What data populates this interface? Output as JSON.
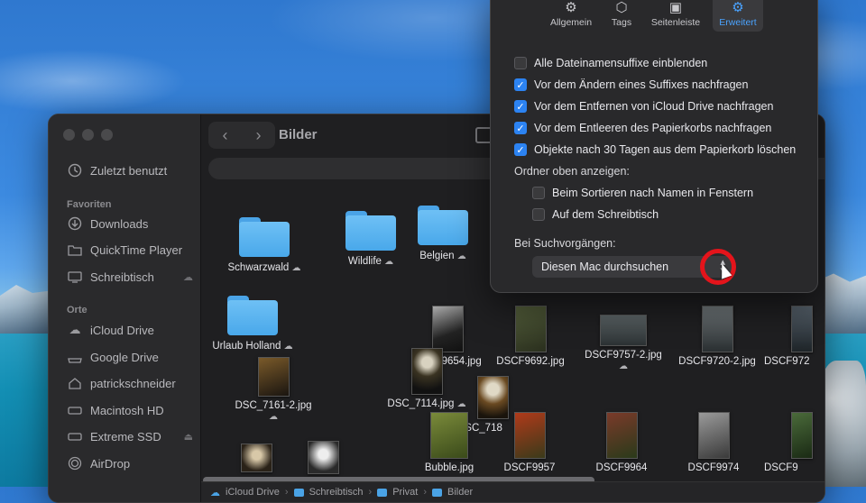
{
  "finder": {
    "title": "Bilder",
    "sidebar": {
      "recent": "Zuletzt benutzt",
      "favorites_header": "Favoriten",
      "favorites": [
        "Downloads",
        "QuickTime Player",
        "Schreibtisch"
      ],
      "places_header": "Orte",
      "places": [
        "iCloud Drive",
        "Google Drive",
        "patrickschneider",
        "Macintosh HD",
        "Extreme SSD",
        "AirDrop"
      ]
    },
    "folders": [
      {
        "name": "Schwarzwald"
      },
      {
        "name": "Wildlife"
      },
      {
        "name": "Belgien"
      },
      {
        "name": "Urlaub Holland"
      }
    ],
    "files": {
      "f1": "DSCF9654.jpg",
      "f2": "DSCF9692.jpg",
      "f3": "DSCF9757-2.jpg",
      "f4": "DSCF9720-2.jpg",
      "f5": "DSCF972",
      "f6": "DSC_7161-2.jpg",
      "f7": "DSC_7114.jpg",
      "f8": "DSC_718",
      "f9": "Bubble.jpg",
      "f10": "DSCF9957",
      "f11": "DSCF9964",
      "f12": "DSCF9974",
      "f13": "DSCF9"
    },
    "path": [
      "iCloud Drive",
      "Schreibtisch",
      "Privat",
      "Bilder"
    ]
  },
  "prefs": {
    "tabs": [
      "Allgemein",
      "Tags",
      "Seitenleiste",
      "Erweitert"
    ],
    "active_tab": "Erweitert",
    "options": [
      {
        "label": "Alle Dateinamensuffixe einblenden",
        "checked": false
      },
      {
        "label": "Vor dem Ändern eines Suffixes nachfragen",
        "checked": true
      },
      {
        "label": "Vor dem Entfernen von iCloud Drive nachfragen",
        "checked": true
      },
      {
        "label": "Vor dem Entleeren des Papierkorbs nachfragen",
        "checked": true
      },
      {
        "label": "Objekte nach 30 Tagen aus dem Papierkorb löschen",
        "checked": true
      }
    ],
    "folders_top_label": "Ordner oben anzeigen:",
    "folders_top": [
      {
        "label": "Beim Sortieren nach Namen in Fenstern",
        "checked": false
      },
      {
        "label": "Auf dem Schreibtisch",
        "checked": false
      }
    ],
    "search_label": "Bei Suchvorgängen:",
    "search_value": "Diesen Mac durchsuchen"
  },
  "colors": {
    "accent": "#2c83f2",
    "highlight_ring": "#e4141b",
    "folder": "#5bb3f0"
  }
}
